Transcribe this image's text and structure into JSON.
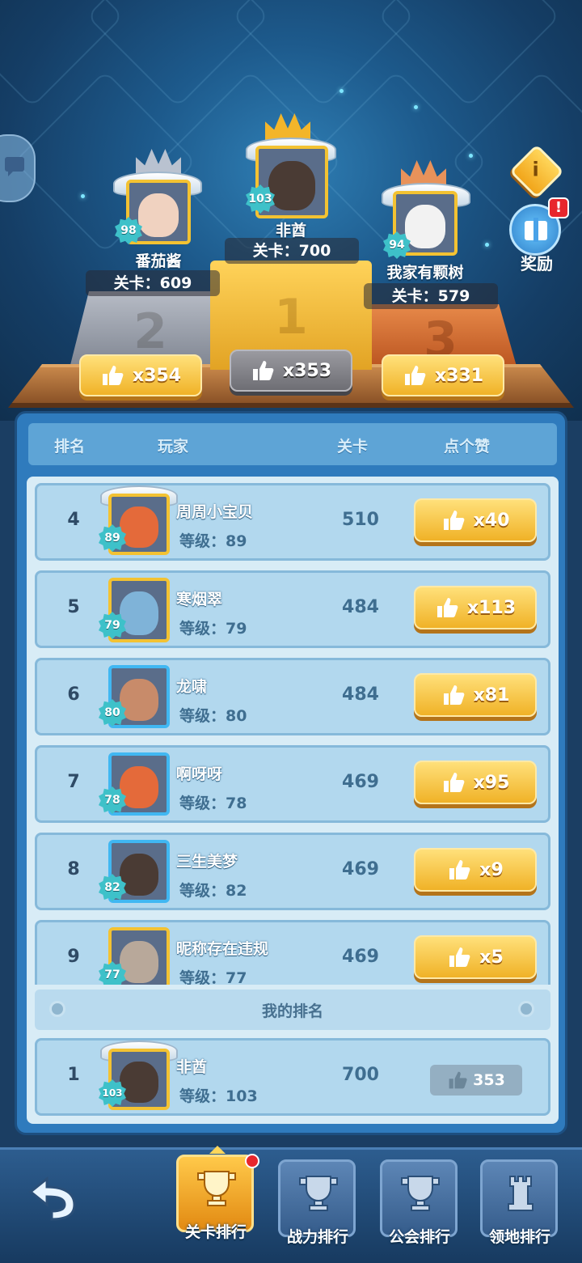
{
  "podium": {
    "first": {
      "name": "非酋",
      "level": "103",
      "stage_text": "关卡：700",
      "likes": "x353"
    },
    "second": {
      "name": "番茄酱",
      "level": "98",
      "stage_text": "关卡：609",
      "likes": "x354"
    },
    "third": {
      "name": "我家有颗树",
      "level": "94",
      "stage_text": "关卡：579",
      "likes": "x331"
    }
  },
  "reward_label": "奖励",
  "reward_badge": "!",
  "info_icon_text": "i",
  "table": {
    "headers": {
      "rank": "排名",
      "player": "玩家",
      "stage": "关卡",
      "like": "点个赞"
    },
    "rows": [
      {
        "rank": "4",
        "name": "周周小宝贝",
        "level_text": "等级：89",
        "level": "89",
        "stage": "510",
        "likes": "x40"
      },
      {
        "rank": "5",
        "name": "寒烟翠",
        "level_text": "等级：79",
        "level": "79",
        "stage": "484",
        "likes": "x113"
      },
      {
        "rank": "6",
        "name": "龙啸",
        "level_text": "等级：80",
        "level": "80",
        "stage": "484",
        "likes": "x81"
      },
      {
        "rank": "7",
        "name": "啊呀呀",
        "level_text": "等级：78",
        "level": "78",
        "stage": "469",
        "likes": "x95"
      },
      {
        "rank": "8",
        "name": "三生美梦",
        "level_text": "等级：82",
        "level": "82",
        "stage": "469",
        "likes": "x9"
      },
      {
        "rank": "9",
        "name": "昵称存在违规",
        "level_text": "等级：77",
        "level": "77",
        "stage": "469",
        "likes": "x5"
      }
    ]
  },
  "my_rank": {
    "title": "我的排名",
    "rank": "1",
    "name": "非酋",
    "level_text": "等级：103",
    "level": "103",
    "stage": "700",
    "likes": "353"
  },
  "nav": {
    "tabs": [
      {
        "label": "关卡排行",
        "active": true
      },
      {
        "label": "战力排行",
        "active": false
      },
      {
        "label": "公会排行",
        "active": false
      },
      {
        "label": "领地排行",
        "active": false
      }
    ]
  },
  "colors": {
    "gold_button": "#f0b227",
    "gray_button": "#7a7a80",
    "panel_blue": "#2f7bbd",
    "row_blue": "#b2d8ee"
  },
  "icons": [
    "back-arrow-icon",
    "thumbs-up-icon",
    "trophy-icon",
    "gift-icon",
    "info-icon",
    "chat-icon"
  ]
}
